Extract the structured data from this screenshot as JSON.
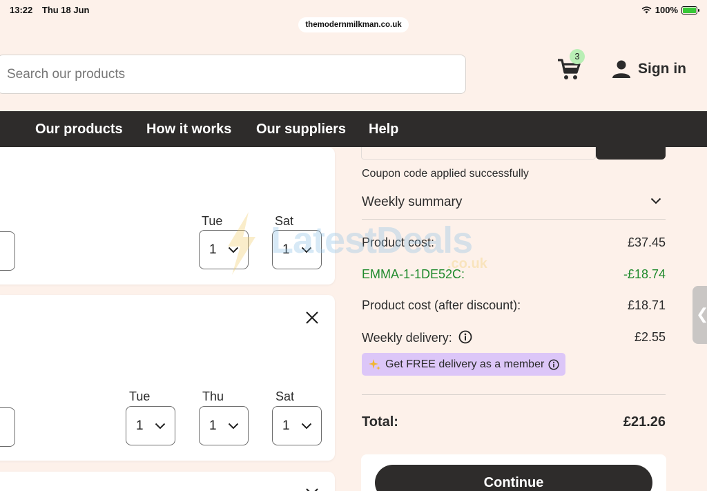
{
  "status_bar": {
    "time": "13:22",
    "date": "Thu 18 Jun",
    "battery": "100%"
  },
  "browser": {
    "url": "themodernmilkman.co.uk"
  },
  "header": {
    "search_placeholder": "Search our products",
    "cart_count": "3",
    "sign_in": "Sign in"
  },
  "nav": {
    "items": [
      "Our products",
      "How it works",
      "Our suppliers",
      "Help"
    ]
  },
  "cards": [
    {
      "days": [
        "Tue",
        "Sat"
      ],
      "quantities": [
        "1",
        "1"
      ]
    },
    {
      "days": [
        "Tue",
        "Thu",
        "Sat"
      ],
      "quantities": [
        "1",
        "1",
        "1"
      ]
    }
  ],
  "summary": {
    "coupon_message": "Coupon code applied successfully",
    "weekly_summary_label": "Weekly summary",
    "product_cost_label": "Product cost:",
    "product_cost_value": "£37.45",
    "coupon_code_label": "EMMA-1-1DE52C:",
    "coupon_discount_value": "-£18.74",
    "after_discount_label": "Product cost (after discount):",
    "after_discount_value": "£18.71",
    "delivery_label": "Weekly delivery:",
    "delivery_value": "£2.55",
    "member_promo": "Get FREE delivery as a member",
    "total_label": "Total:",
    "total_value": "£21.26",
    "continue_label": "Continue"
  },
  "watermark": {
    "text": "LatestDeals",
    "sub": ".co.uk"
  },
  "colors": {
    "background": "#fdf1ea",
    "nav_bg": "#2e2c2b",
    "discount_green": "#1f8a2c",
    "member_purple": "#dcc6f8",
    "cart_badge": "#b9efb5"
  }
}
